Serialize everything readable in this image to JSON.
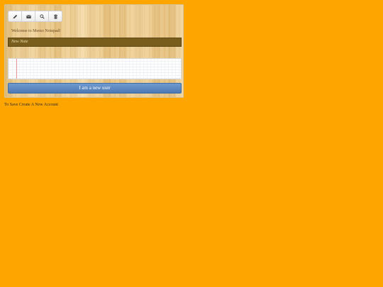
{
  "toolbar": {
    "buttons": [
      {
        "icon": "pencil-icon"
      },
      {
        "icon": "envelope-icon"
      },
      {
        "icon": "search-icon"
      },
      {
        "icon": "trash-icon"
      }
    ]
  },
  "welcome_text": "Welcome to Memo Notepad!",
  "note": {
    "header_title": "New Note",
    "body": ""
  },
  "new_user_button_label": "I am a new user",
  "save_link_text": "To Save Create A New Account",
  "colors": {
    "page_background": "#ffa500",
    "note_header": "#785d1c",
    "button_blue": "#5a85bf"
  }
}
